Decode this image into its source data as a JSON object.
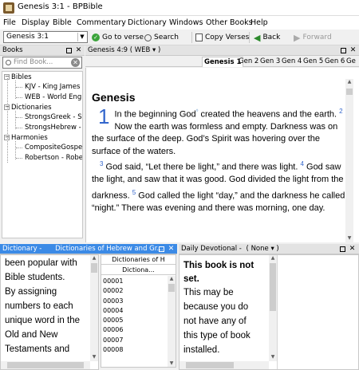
{
  "window": {
    "title": "Genesis 3:1 - BPBible"
  },
  "menu": [
    "File",
    "Display",
    "Bible",
    "Commentary",
    "Dictionary",
    "Windows",
    "Other Books",
    "Help"
  ],
  "toolbar": {
    "reference": "Genesis 3:1",
    "goto_label": "Go to verse",
    "search_label": "Search",
    "copy_label": "Copy Verses",
    "back_label": "Back",
    "forward_label": "Forward"
  },
  "books_pane": {
    "title": "Books",
    "search_placeholder": "Find Book...",
    "tree": [
      {
        "label": "Bibles",
        "children": [
          "KJV - King James",
          "WEB - World Eng"
        ]
      },
      {
        "label": "Dictionaries",
        "children": [
          "StrongsGreek - St",
          "StrongsHebrew -"
        ]
      },
      {
        "label": "Harmonies",
        "children": [
          "CompositeGospe",
          "Robertson - Robe"
        ]
      }
    ]
  },
  "bible_pane": {
    "title": "Genesis 4:9 ( WEB ▾ )",
    "tabs": [
      "Genesis 1",
      "Gen 2",
      "Gen 3",
      "Gen 4",
      "Gen 5",
      "Gen 6",
      "Ge"
    ],
    "active_tab": "Genesis 1",
    "book_heading": "Genesis",
    "chapter": "1",
    "verse1": "In the beginning God",
    "verse1_link": "⁰",
    "verse1_end": " created the heavens and the earth.",
    "v2": "2",
    "verse2": " Now the earth was formless and empty. Darkness was on the surface of the deep. God’s Spirit was hovering over the surface of the waters.",
    "v3": "3",
    "verse3": " God said, “Let there be light,” and there was light.",
    "v4": "4",
    "verse4": " God saw the light, and saw that it was good. God divided the light from the darkness.",
    "v5": "5",
    "verse5": " God called the light “day,” and the darkness he called “night.” There was evening and there was morning, one day."
  },
  "dictionary_pane": {
    "title": "Dictionary -",
    "module": "Dictionaries of Hebrew and Gr...",
    "text_lines": [
      "been popular with",
      "Bible students.",
      "By assigning",
      "numbers to each",
      "unique word in the",
      "Old and New",
      "Testaments and"
    ],
    "list_header": "Dictionaries of H",
    "list_subheader": "Dictiona...",
    "keys": [
      "00001",
      "00002",
      "00003",
      "00004",
      "00005",
      "00006",
      "00007",
      "00008"
    ]
  },
  "devotional_pane": {
    "title": "Daily Devotional -",
    "module": "( None ▾ )",
    "bold_lines": [
      "This book is not",
      "set."
    ],
    "text_lines": [
      "This may be",
      "because you do",
      "not have any of",
      "this type of book",
      "installed."
    ]
  },
  "colors": {
    "active_header": "#3b8ae6",
    "verse_number": "#3366cc"
  }
}
